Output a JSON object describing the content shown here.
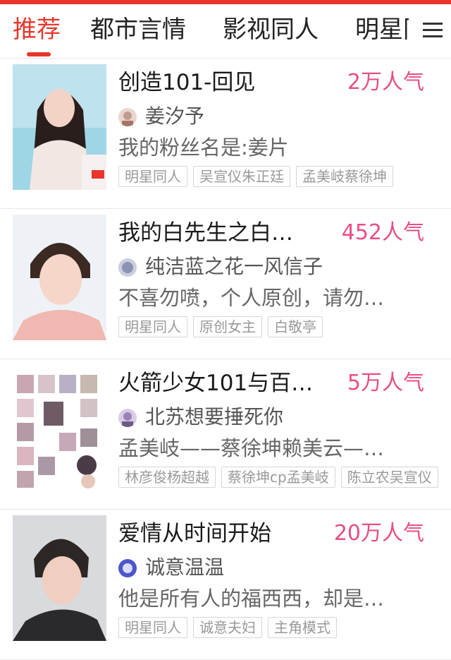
{
  "tabs": [
    "推荐",
    "都市言情",
    "影视同人",
    "明星同人"
  ],
  "cards": [
    {
      "title": "创造101-回见",
      "popularity": "2万人气",
      "author": "姜汐予",
      "description": "我的粉丝名是:姜片",
      "tags": [
        "明星同人",
        "吴宣仪朱正廷",
        "孟美岐蔡徐坤"
      ]
    },
    {
      "title": "我的白先生之白…",
      "popularity": "452人气",
      "author": "纯洁蓝之花一风信子",
      "description": "不喜勿喷，个人原创，请勿…",
      "tags": [
        "明星同人",
        "原创女主",
        "白敬亭"
      ]
    },
    {
      "title": "火箭少女101与百…",
      "popularity": "5万人气",
      "author": "北苏想要捶死你",
      "description": "孟美岐——蔡徐坤赖美云—…",
      "tags": [
        "林彦俊杨超越",
        "蔡徐坤cp孟美岐",
        "陈立农吴宣仪"
      ]
    },
    {
      "title": "爱情从时间开始",
      "popularity": "20万人气",
      "author": "诚意温温",
      "description": "他是所有人的福西西，却是…",
      "tags": [
        "明星同人",
        "诚意夫妇",
        "主角模式"
      ]
    }
  ],
  "colors": {
    "accent": "#e8362c",
    "popularity": "#e84e87"
  },
  "icons": {
    "menu": "menu-icon"
  }
}
